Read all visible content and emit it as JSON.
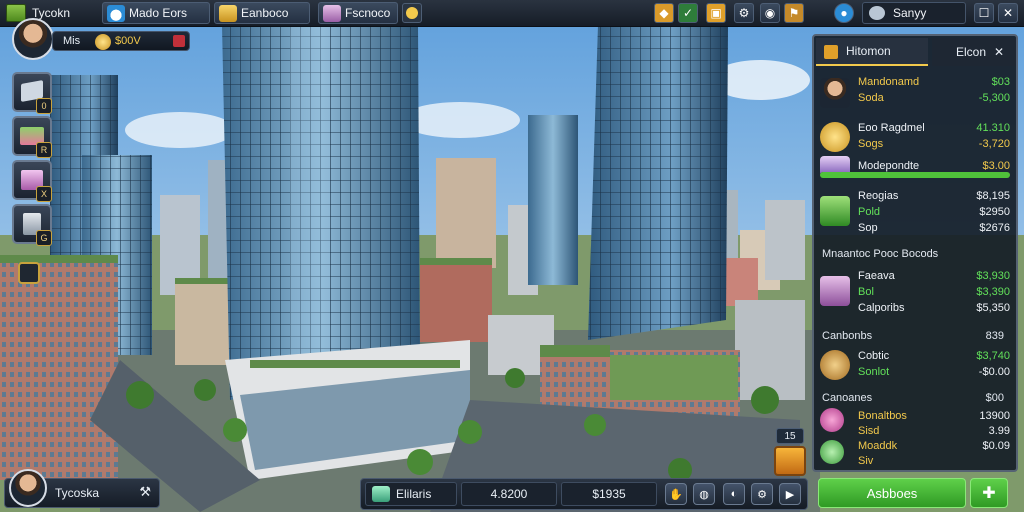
{
  "topbar": {
    "app_title": "Tycokn",
    "tabs": [
      {
        "label": "Mado Eors",
        "icon": "cloud-icon"
      },
      {
        "label": "Eanboco",
        "icon": "gold-bars-icon"
      },
      {
        "label": "Fscnoco",
        "icon": "crate-icon"
      }
    ],
    "right_status": "Sanyy",
    "colors": {
      "accent": "#2b8cd6",
      "gold": "#f2c94c",
      "green": "#62e05a"
    }
  },
  "player": {
    "name_short": "Mis",
    "money": "$00V",
    "bottom_name": "Tycoska"
  },
  "side_menu": [
    {
      "badge": "0",
      "icon": "building-card-icon"
    },
    {
      "badge": "R",
      "icon": "cash-stack-icon"
    },
    {
      "badge": "X",
      "icon": "pink-crate-icon"
    },
    {
      "badge": "G",
      "icon": "server-icon"
    }
  ],
  "panel": {
    "tab_main": "Hitomon",
    "tab_second": "Elcon",
    "rows_a": [
      {
        "label": "Mandonamd",
        "value": "$03",
        "vclass": "green"
      },
      {
        "label": "Soda",
        "value": "-5,300",
        "vclass": "green"
      },
      {
        "label": "Eoo Ragdmel",
        "value": "41.310",
        "vclass": "green"
      },
      {
        "label": "Sogs",
        "value": "-3,720",
        "vclass": "gold"
      },
      {
        "label": "Modepondte",
        "value": "$3.00",
        "vclass": "gold"
      }
    ],
    "rows_b": [
      {
        "label": "Reogias",
        "value": "$8,195",
        "vclass": "white"
      },
      {
        "label": "Pold",
        "value": "$2950",
        "vclass": "white"
      },
      {
        "label": "Sop",
        "value": "$2676",
        "vclass": "white"
      }
    ],
    "section_c": "Mnaantoc Pooc Bocods",
    "rows_c": [
      {
        "label": "Faeava",
        "value": "$3,930",
        "vclass": "green"
      },
      {
        "label": "Bol",
        "value": "$3,390",
        "vclass": "green"
      },
      {
        "label": "Calporibs",
        "value": "$5,350",
        "vclass": "white"
      }
    ],
    "section_d_label": "Canbonbs",
    "section_d_value": "839",
    "rows_d": [
      {
        "label": "Cobtic",
        "value": "$3,740",
        "vclass": "green"
      },
      {
        "label": "Sonlot",
        "value": "-$0.00",
        "vclass": "white"
      }
    ],
    "section_e_label": "Canoanes",
    "section_e_value": "$00",
    "rows_e": [
      {
        "label": "Bonaltbos",
        "value": "13900",
        "vclass": "white"
      },
      {
        "label": "Sisd",
        "value": "3.99",
        "vclass": "white"
      },
      {
        "label": "Moaddk",
        "value": "$0.09",
        "vclass": "white"
      },
      {
        "label": "Siv",
        "value": "",
        "vclass": "white"
      }
    ]
  },
  "bottombar": {
    "label": "Elilaris",
    "value_a": "4.8200",
    "value_b": "$1935",
    "action_label": "Asbboes"
  },
  "notice": {
    "count": "15"
  }
}
